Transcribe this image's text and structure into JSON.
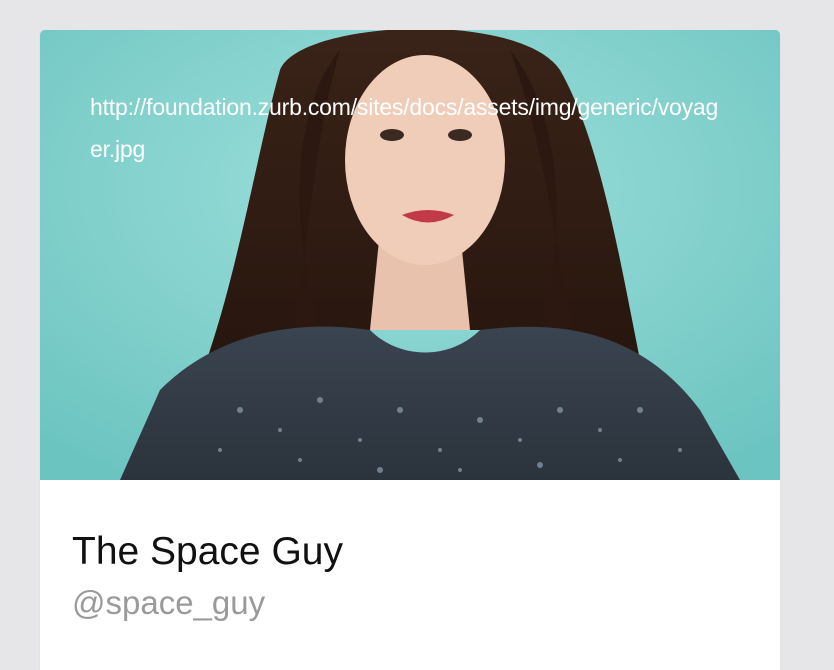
{
  "card": {
    "image": {
      "alt_text": "http://foundation.zurb.com/sites/docs/assets/img/generic/voyager.jpg",
      "background_color": "#7fcfcb",
      "description_icon": "portrait-photo"
    },
    "title": "The Space Guy",
    "handle": "@space_guy"
  },
  "colors": {
    "page_background": "#e6e6e8",
    "card_background": "#ffffff",
    "title": "#111111",
    "handle": "#9a9a9a"
  }
}
